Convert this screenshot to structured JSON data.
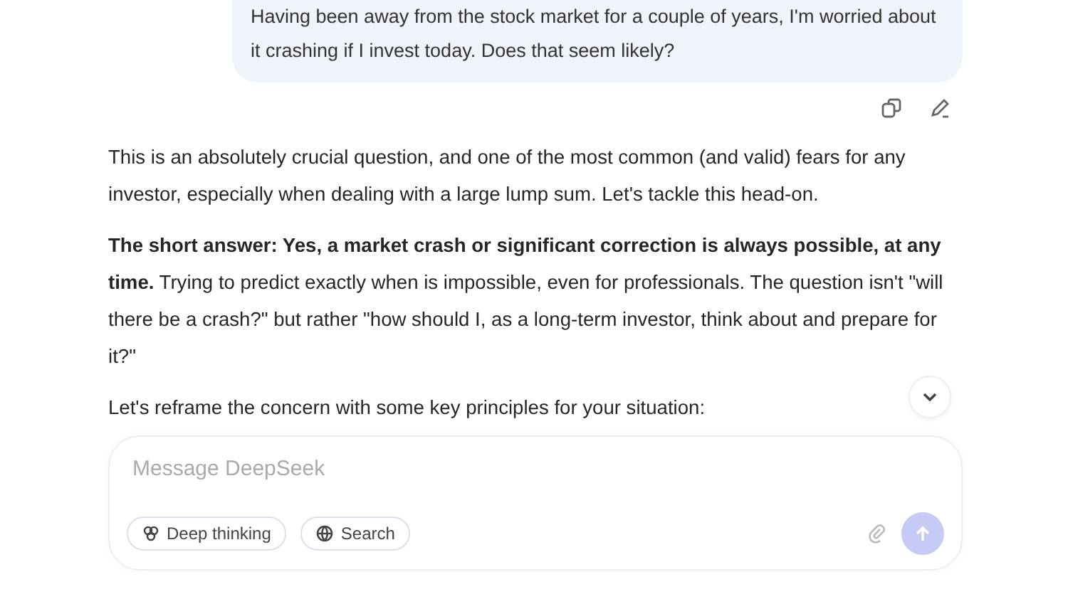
{
  "user_message": {
    "text": "Having been away from the stock market for a couple of years, I'm worried about it crashing if I invest today. Does that seem likely?"
  },
  "reply": {
    "paragraphs": [
      "This is an absolutely crucial question, and one of the most common (and valid) fears for any investor, especially when dealing with a large lump sum. Let's tackle this head-on.",
      "**The short answer: Yes, a market crash or significant correction is always possible, at any time.** Trying to predict exactly when is impossible, even for professionals. The question isn't \"will there be a crash?\" but rather \"how should I, as a long-term investor, think about and prepare for it?\"",
      "Let's reframe the concern with some key principles for your situation:"
    ]
  },
  "composer": {
    "placeholder": "Message DeepSeek",
    "toggles": [
      {
        "label": "Deep thinking",
        "kind": "think",
        "selected": false
      },
      {
        "label": "Search",
        "kind": "search",
        "selected": false
      }
    ]
  }
}
